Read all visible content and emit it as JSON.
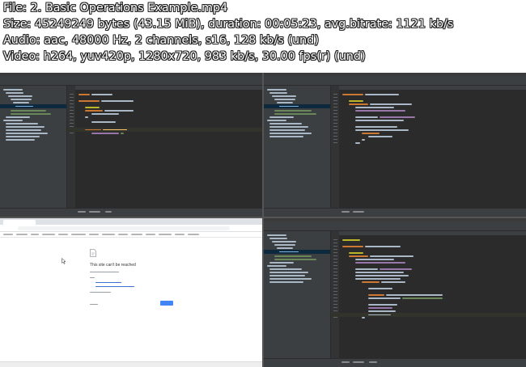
{
  "header": {
    "line1": "File: 2. Basic Operations Example.mp4",
    "line2": "Size: 45249249 bytes (43.15 MiB), duration: 00:05:23, avg.bitrate: 1121 kb/s",
    "line3": "Audio: aac, 48000 Hz, 2 channels, s16, 128 kb/s (und)",
    "line4": "Video: h264, yuv420p, 1280x720, 983 kb/s, 30.00 fps(r) (und)"
  },
  "browser": {
    "error_title": "This site can't be reached"
  },
  "colors": {
    "ide_bg": "#2b2b2b",
    "ide_panel": "#3c3f41",
    "code_orange": "#cc7832",
    "code_text": "#a9b7c6",
    "code_green": "#6a8759",
    "code_purple": "#9876aa",
    "code_yellow": "#bbb529",
    "browser_blue": "#4285f4"
  }
}
